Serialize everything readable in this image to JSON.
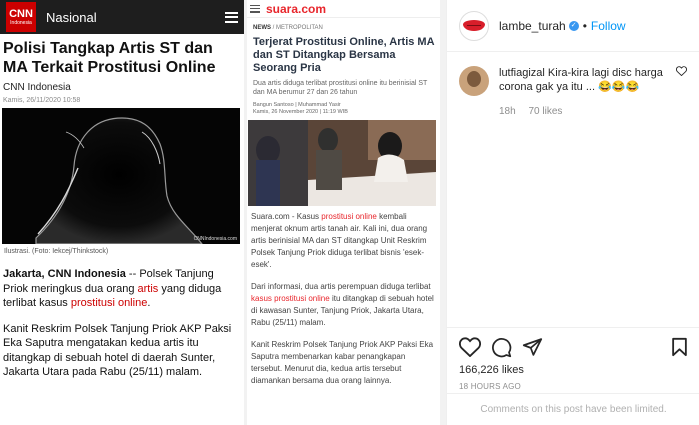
{
  "cnn": {
    "logo_text": "CNN",
    "logo_sub": "Indonesia",
    "section": "Nasional",
    "title": "Polisi Tangkap Artis ST dan MA Terkait Prostitusi Online",
    "source": "CNN Indonesia",
    "date": "Kamis, 26/11/2020 10:58",
    "photo_credit_logo": "CNNIndonesia.com",
    "caption": "Ilustrasi. (Foto: Iekcej/Thinkstock)",
    "p1_lead": "Jakarta, CNN Indonesia",
    "p1_a": " -- Polsek Tanjung Priok meringkus dua orang ",
    "p1_link1": "artis",
    "p1_b": " yang diduga terlibat kasus ",
    "p1_link2": "prostitusi online",
    "p1_c": ".",
    "p2": "Kanit Reskrim Polsek Tanjung Priok AKP Paksi Eka Saputra mengatakan kedua artis itu ditangkap di sebuah hotel di daerah Sunter, Jakarta Utara pada Rabu (25/11) malam."
  },
  "suara": {
    "logo": "suara.com",
    "crumb_a": "NEWS",
    "crumb_b": " / METROPOLITAN",
    "title": "Terjerat Prostitusi Online, Artis MA dan ST Ditangkap Bersama Seorang Pria",
    "lead": "Dua artis diduga terlibat prostitusi online itu berinisial ST dan MA berumur 27 dan 26 tahun",
    "authors": "Bangun Santoso | Muhammad Yasir",
    "published": "Kamis, 26 November 2020 | 11:19 WIB",
    "p1_a": "Suara.com - Kasus ",
    "p1_link": "prostitusi online",
    "p1_b": " kembali menjerat oknum artis tanah air. Kali ini, dua orang artis berinisial MA dan ST ditangkap Unit Reskrim Polsek Tanjung Priok diduga terlibat bisnis 'esek-esek'.",
    "p2_a": "Dari informasi, dua artis perempuan diduga terlibat ",
    "p2_link": "kasus prostitusi online",
    "p2_b": " itu ditangkap di sebuah hotel di kawasan Sunter, Tanjung Priok, Jakarta Utara, Rabu (25/11) malam.",
    "p3": "Kanit Reskrim Polsek Tanjung Priok AKP Paksi Eka Saputra membenarkan kabar penangkapan tersebut. Menurut dia, kedua artis tersebut diamankan bersama dua orang lainnya."
  },
  "sidebar": {
    "username": "lambe_turah",
    "verified_glyph": "✓",
    "separator": "•",
    "follow_label": "Follow",
    "comment": {
      "user": "lutfiagizal",
      "text": "Kira-kira lagi disc harga corona gak ya itu ... 😂😂😂",
      "age": "18h",
      "likes": "70 likes"
    },
    "likes": "166,226 likes",
    "post_age": "18 HOURS AGO",
    "comments_limited": "Comments on this post have been limited."
  },
  "colors": {
    "accent_blue": "#0095f6",
    "cnn_red": "#cc0000",
    "suara_red": "#e8262c"
  }
}
